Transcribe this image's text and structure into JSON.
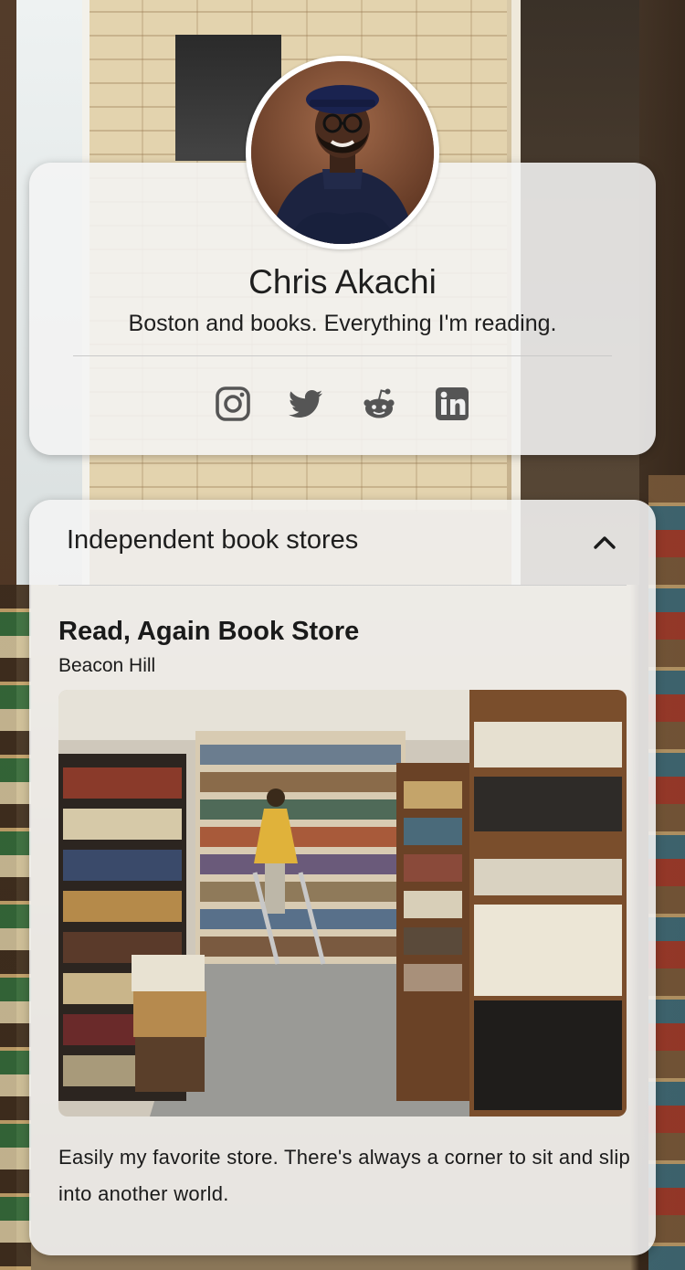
{
  "profile": {
    "name": "Chris Akachi",
    "bio": "Boston and books. Everything I'm reading.",
    "socials": [
      {
        "icon": "instagram-icon",
        "label": "Instagram"
      },
      {
        "icon": "twitter-icon",
        "label": "Twitter"
      },
      {
        "icon": "reddit-icon",
        "label": "Reddit"
      },
      {
        "icon": "linkedin-icon",
        "label": "LinkedIn"
      }
    ]
  },
  "section": {
    "title": "Independent book stores",
    "expanded": true,
    "toggle_icon": "chevron-up-icon"
  },
  "store": {
    "name": "Read, Again Book Store",
    "location": "Beacon Hill",
    "description": "Easily my favorite store. There's always a corner to sit and slip into another world."
  },
  "colors": {
    "card_background": "#f4f4f4",
    "text": "#1e1e1e",
    "icon": "#555555"
  }
}
